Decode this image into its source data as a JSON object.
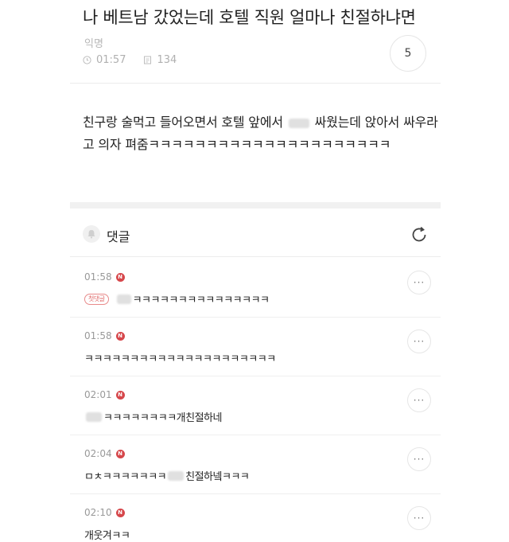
{
  "post": {
    "title": "나 베트남 갔었는데 호텔 직원 얼마나 친절하냐면",
    "author": "익명",
    "time": "01:57",
    "views": "134",
    "comment_count": "5",
    "body_part1": "친구랑 술먹고 들어오면서 호텔 앞에서",
    "body_part2": "싸웠는데 앉아서 싸우라고 의자 펴줌ㅋㅋㅋㅋㅋㅋㅋㅋㅋㅋㅋㅋㅋㅋㅋㅋㅋㅋㅋㅋㅋ"
  },
  "comments_header": {
    "label": "댓글"
  },
  "comments": [
    {
      "time": "01:58",
      "badge": "N",
      "first_label": "첫댓글",
      "text": "ㅋㅋㅋㅋㅋㅋㅋㅋㅋㅋㅋㅋㅋㅋㅋ"
    },
    {
      "time": "01:58",
      "badge": "N",
      "text": "ㅋㅋㅋㅋㅋㅋㅋㅋㅋㅋㅋㅋㅋㅋㅋㅋㅋㅋㅋㅋㅋ"
    },
    {
      "time": "02:01",
      "badge": "N",
      "text": "ㅋㅋㅋㅋㅋㅋㅋㅋ개친절하네"
    },
    {
      "time": "02:04",
      "badge": "N",
      "text_a": "ㅁㅊㅋㅋㅋㅋㅋㅋㅋ",
      "text_b": "친절하넼ㅋㅋㅋ"
    },
    {
      "time": "02:10",
      "badge": "N",
      "text": "개웃겨ㅋㅋ"
    }
  ],
  "more_label": "···",
  "icons": {
    "clock": "clock-icon",
    "views": "document-icon",
    "bell": "bell-icon",
    "refresh": "refresh-icon",
    "more": "more-icon"
  },
  "colors": {
    "badge": "#d6474b",
    "first_badge": "#e06a6a"
  }
}
